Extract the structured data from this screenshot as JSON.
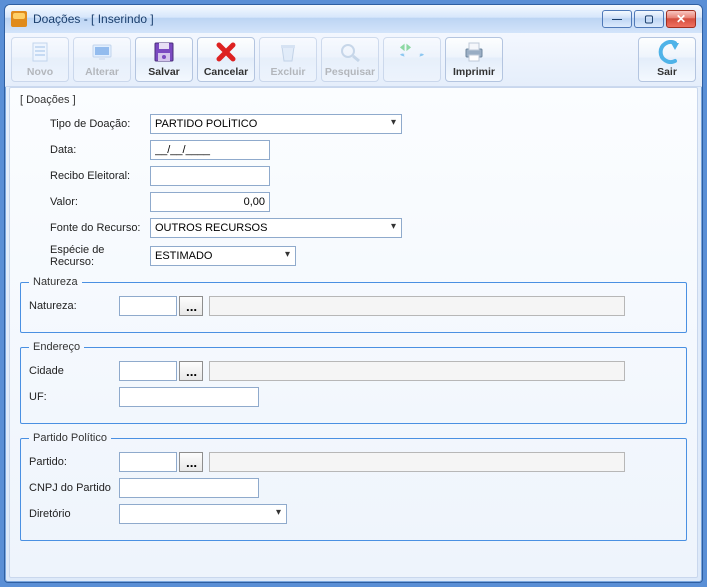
{
  "window": {
    "title": "Doações - [ Inserindo ]"
  },
  "toolbar": {
    "novo": "Novo",
    "alterar": "Alterar",
    "salvar": "Salvar",
    "cancelar": "Cancelar",
    "excluir": "Excluir",
    "pesquisar": "Pesquisar",
    "imprimir": "Imprimir",
    "sair": "Sair"
  },
  "section": {
    "tag": "[ Doações ]"
  },
  "fields": {
    "tipo_doacao_label": "Tipo de Doação:",
    "tipo_doacao_value": "PARTIDO POLÍTICO",
    "data_label": "Data:",
    "data_value": "__/__/____",
    "recibo_label": "Recibo Eleitoral:",
    "recibo_value": "",
    "valor_label": "Valor:",
    "valor_value": "0,00",
    "fonte_label": "Fonte do Recurso:",
    "fonte_value": "OUTROS RECURSOS",
    "especie_label": "Espécie de Recurso:",
    "especie_value": "ESTIMADO"
  },
  "natureza": {
    "legend": "Natureza",
    "label": "Natureza:",
    "code": "",
    "desc": "",
    "browse": "..."
  },
  "endereco": {
    "legend": "Endereço",
    "cidade_label": "Cidade",
    "cidade_code": "",
    "cidade_desc": "",
    "browse": "...",
    "uf_label": "UF:",
    "uf_value": ""
  },
  "partido": {
    "legend": "Partido Político",
    "partido_label": "Partido:",
    "partido_code": "",
    "partido_desc": "",
    "browse": "...",
    "cnpj_label": "CNPJ do Partido",
    "cnpj_value": "",
    "diretorio_label": "Diretório",
    "diretorio_value": ""
  }
}
